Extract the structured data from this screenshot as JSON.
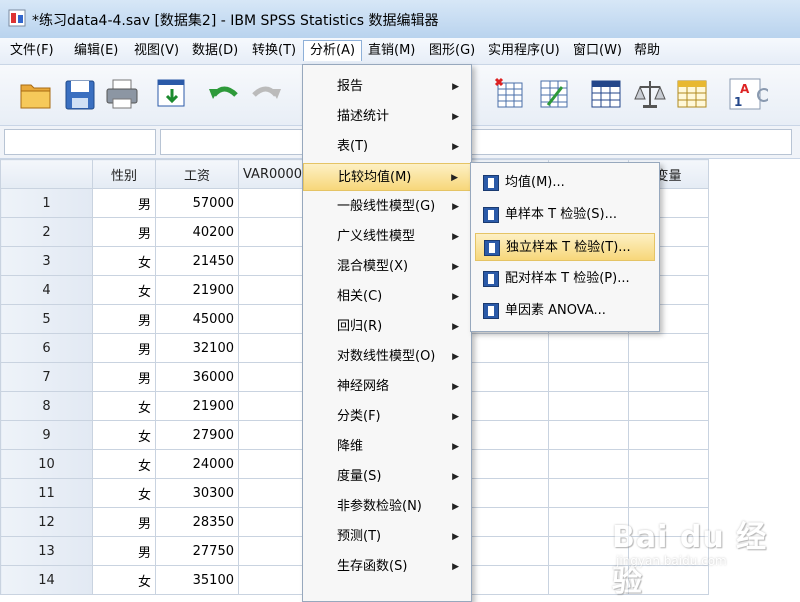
{
  "window": {
    "title": "*练习data4-4.sav [数据集2] - IBM SPSS Statistics 数据编辑器"
  },
  "menubar": [
    {
      "label": "文件(F)"
    },
    {
      "label": "编辑(E)"
    },
    {
      "label": "视图(V)"
    },
    {
      "label": "数据(D)"
    },
    {
      "label": "转换(T)"
    },
    {
      "label": "分析(A)",
      "active": true
    },
    {
      "label": "直销(M)"
    },
    {
      "label": "图形(G)"
    },
    {
      "label": "实用程序(U)"
    },
    {
      "label": "窗口(W)"
    },
    {
      "label": "帮助"
    }
  ],
  "toolbar": {
    "icons": [
      "open-folder-icon",
      "save-icon",
      "print-icon",
      "dialog-recall-icon",
      "undo-icon",
      "redo-icon",
      "insert-cases-icon",
      "select-variables-icon",
      "split-file-icon",
      "weight-cases-icon",
      "select-cases-icon",
      "value-labels-icon"
    ]
  },
  "grid": {
    "columns": [
      "性别",
      "工资",
      "VAR0000",
      "",
      "",
      "",
      "变量",
      "变量"
    ],
    "rows": [
      {
        "n": "1",
        "sex": "男",
        "wage": "57000"
      },
      {
        "n": "2",
        "sex": "男",
        "wage": "40200"
      },
      {
        "n": "3",
        "sex": "女",
        "wage": "21450"
      },
      {
        "n": "4",
        "sex": "女",
        "wage": "21900"
      },
      {
        "n": "5",
        "sex": "男",
        "wage": "45000"
      },
      {
        "n": "6",
        "sex": "男",
        "wage": "32100"
      },
      {
        "n": "7",
        "sex": "男",
        "wage": "36000"
      },
      {
        "n": "8",
        "sex": "女",
        "wage": "21900"
      },
      {
        "n": "9",
        "sex": "女",
        "wage": "27900"
      },
      {
        "n": "10",
        "sex": "女",
        "wage": "24000"
      },
      {
        "n": "11",
        "sex": "女",
        "wage": "30300"
      },
      {
        "n": "12",
        "sex": "男",
        "wage": "28350"
      },
      {
        "n": "13",
        "sex": "男",
        "wage": "27750"
      },
      {
        "n": "14",
        "sex": "女",
        "wage": "35100"
      }
    ]
  },
  "analyze_menu": {
    "items": [
      {
        "label": "报告",
        "submenu": true
      },
      {
        "label": "描述统计",
        "submenu": true
      },
      {
        "label": "表(T)",
        "submenu": true
      },
      {
        "label": "比较均值(M)",
        "submenu": true,
        "highlighted": true
      },
      {
        "label": "一般线性模型(G)",
        "submenu": true
      },
      {
        "label": "广义线性模型",
        "submenu": true
      },
      {
        "label": "混合模型(X)",
        "submenu": true
      },
      {
        "label": "相关(C)",
        "submenu": true
      },
      {
        "label": "回归(R)",
        "submenu": true
      },
      {
        "label": "对数线性模型(O)",
        "submenu": true
      },
      {
        "label": "神经网络",
        "submenu": true
      },
      {
        "label": "分类(F)",
        "submenu": true
      },
      {
        "label": "降维",
        "submenu": true
      },
      {
        "label": "度量(S)",
        "submenu": true
      },
      {
        "label": "非参数检验(N)",
        "submenu": true
      },
      {
        "label": "预测(T)",
        "submenu": true
      },
      {
        "label": "生存函数(S)",
        "submenu": true
      }
    ]
  },
  "compare_means_submenu": {
    "items": [
      {
        "label": "均值(M)...",
        "icon": "means-icon"
      },
      {
        "label": "单样本 T 检验(S)...",
        "icon": "one-sample-t-icon"
      },
      {
        "label": "独立样本 T 检验(T)...",
        "icon": "independent-t-icon",
        "highlighted": true
      },
      {
        "label": "配对样本 T 检验(P)...",
        "icon": "paired-t-icon"
      },
      {
        "label": "单因素 ANOVA...",
        "icon": "anova-icon"
      }
    ]
  },
  "watermark": {
    "brand": "Bai du 经验",
    "url": "jingyan.baidu.com"
  }
}
